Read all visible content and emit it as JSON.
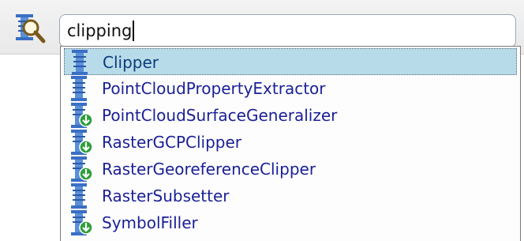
{
  "search": {
    "value": "clipping"
  },
  "dropdown": {
    "items": [
      {
        "label": "Clipper",
        "icon": "transformer-icon",
        "selected": true
      },
      {
        "label": "PointCloudPropertyExtractor",
        "icon": "transformer-icon",
        "selected": false
      },
      {
        "label": "PointCloudSurfaceGeneralizer",
        "icon": "transformer-download-icon",
        "selected": false
      },
      {
        "label": "RasterGCPClipper",
        "icon": "transformer-download-icon",
        "selected": false
      },
      {
        "label": "RasterGeoreferenceClipper",
        "icon": "transformer-download-icon",
        "selected": false
      },
      {
        "label": "RasterSubsetter",
        "icon": "transformer-icon",
        "selected": false
      },
      {
        "label": "SymbolFiller",
        "icon": "transformer-download-icon",
        "selected": false
      }
    ]
  },
  "colors": {
    "selection": "#b8dbe9",
    "item_text": "#1a1f96",
    "icon_blue": "#3a6fc4",
    "badge_green": "#2e9e3a"
  }
}
